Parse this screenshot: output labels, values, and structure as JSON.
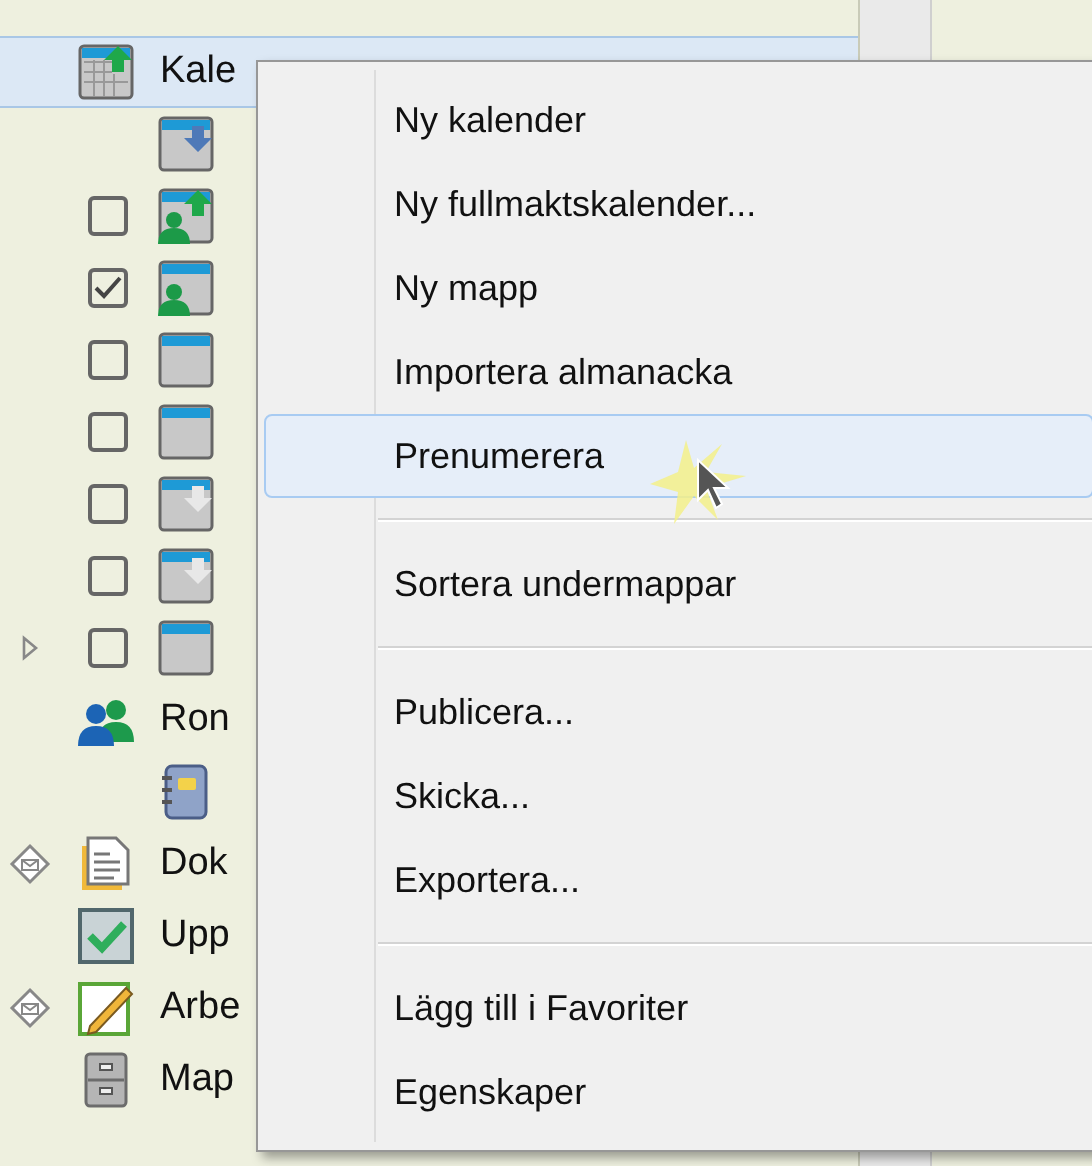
{
  "tree": [
    {
      "kind": "calendar-share",
      "label": "Kale",
      "selected": true,
      "expandable": false,
      "mail_marker": false,
      "children": [
        {
          "kind": "calendar-in",
          "selected": false,
          "expandable": false,
          "mail_marker": false
        },
        {
          "kind": "person-share",
          "selected": false,
          "expandable": false,
          "mail_marker": false,
          "checkbox": {
            "checked": false
          }
        },
        {
          "kind": "person",
          "selected": false,
          "expandable": false,
          "mail_marker": false,
          "checkbox": {
            "checked": true
          }
        },
        {
          "kind": "calendar",
          "selected": false,
          "expandable": false,
          "mail_marker": false,
          "checkbox": {
            "checked": false
          }
        },
        {
          "kind": "calendar",
          "selected": false,
          "expandable": false,
          "mail_marker": false,
          "checkbox": {
            "checked": false
          }
        },
        {
          "kind": "calendar-in-grey",
          "selected": false,
          "expandable": false,
          "mail_marker": false,
          "checkbox": {
            "checked": false
          }
        },
        {
          "kind": "calendar-in-grey",
          "selected": false,
          "expandable": false,
          "mail_marker": false,
          "checkbox": {
            "checked": false
          }
        },
        {
          "kind": "calendar",
          "selected": false,
          "expandable": true,
          "mail_marker": false,
          "checkbox": {
            "checked": false
          }
        }
      ]
    },
    {
      "kind": "people",
      "label": "Ron",
      "selected": false,
      "expandable": false,
      "mail_marker": false,
      "children": [
        {
          "kind": "notebook",
          "selected": false,
          "expandable": false,
          "mail_marker": false
        }
      ]
    },
    {
      "kind": "document",
      "label": "Dok",
      "selected": false,
      "expandable": false,
      "mail_marker": true
    },
    {
      "kind": "task",
      "label": "Upp",
      "selected": false,
      "expandable": false,
      "mail_marker": false
    },
    {
      "kind": "pencil",
      "label": "Arbe",
      "selected": false,
      "expandable": false,
      "mail_marker": true
    },
    {
      "kind": "cabinet",
      "label": "Map",
      "selected": false,
      "expandable": false,
      "mail_marker": false
    }
  ],
  "context_menu": {
    "groups": [
      [
        {
          "label": "Ny kalender",
          "selected": false
        },
        {
          "label": "Ny fullmaktskalender...",
          "selected": false
        },
        {
          "label": "Ny mapp",
          "selected": false
        },
        {
          "label": "Importera almanacka",
          "selected": false
        },
        {
          "label": "Prenumerera",
          "selected": true
        }
      ],
      [
        {
          "label": "Sortera undermappar",
          "selected": false
        }
      ],
      [
        {
          "label": "Publicera...",
          "selected": false
        },
        {
          "label": "Skicka...",
          "selected": false
        },
        {
          "label": "Exportera...",
          "selected": false
        }
      ],
      [
        {
          "label": "Lägg till i Favoriter",
          "selected": false
        },
        {
          "label": "Egenskaper",
          "selected": false
        }
      ]
    ]
  }
}
